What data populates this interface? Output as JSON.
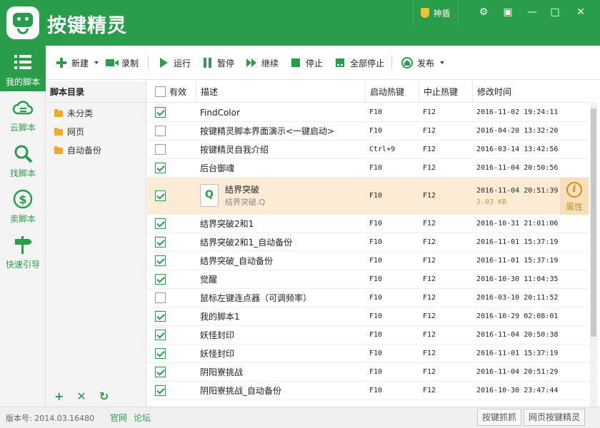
{
  "app": {
    "title": "按键精灵",
    "shield_label": "神盾"
  },
  "window_controls": {
    "settings": "⚙",
    "menu": "▣",
    "minimize": "—",
    "maximize": "□",
    "close": "✕"
  },
  "nav": [
    {
      "label": "我的脚本",
      "icon": "list-icon",
      "active": true
    },
    {
      "label": "云脚本",
      "icon": "cloud-icon",
      "active": false
    },
    {
      "label": "找脚本",
      "icon": "search-icon",
      "active": false
    },
    {
      "label": "卖脚本",
      "icon": "dollar-icon",
      "active": false
    },
    {
      "label": "快速引导",
      "icon": "signpost-icon",
      "active": false
    }
  ],
  "toolbar": {
    "new": "新建",
    "record": "录制",
    "run": "运行",
    "pause": "暂停",
    "resume": "继续",
    "stop": "停止",
    "stop_all": "全部停止",
    "publish": "发布"
  },
  "tree": {
    "header": "脚本目录",
    "folders": [
      "未分类",
      "网页",
      "自动备份"
    ],
    "actions": {
      "add": "+",
      "delete": "✕",
      "refresh": "↻"
    }
  },
  "grid": {
    "columns": [
      "有效",
      "描述",
      "启动热键",
      "中止热键",
      "修改时间"
    ],
    "rows": [
      {
        "enabled": true,
        "desc": "FindColor",
        "start": "F10",
        "stop": "F12",
        "time": "2016-11-02 19:24:11"
      },
      {
        "enabled": false,
        "desc": "按键精灵脚本界面演示<一键启动>",
        "start": "F10",
        "stop": "F12",
        "time": "2016-04-20 13:32:20"
      },
      {
        "enabled": false,
        "desc": "按键精灵自我介绍",
        "start": "Ctrl+9",
        "stop": "F12",
        "time": "2016-03-14 13:42:56"
      },
      {
        "enabled": true,
        "desc": "后台御魂",
        "start": "F10",
        "stop": "F12",
        "time": "2016-11-04 20:50:56"
      },
      {
        "enabled": true,
        "desc": "结界突破",
        "file": "结界突破.Q",
        "size": "2.03 KB",
        "start": "F10",
        "stop": "F12",
        "time": "2016-11-04 20:51:39",
        "selected": true,
        "prop_label": "属性"
      },
      {
        "enabled": true,
        "desc": "结界突破2和1",
        "start": "F10",
        "stop": "F12",
        "time": "2016-10-31 21:01:06"
      },
      {
        "enabled": true,
        "desc": "结界突破2和1_自动备份",
        "start": "F10",
        "stop": "F12",
        "time": "2016-11-01 15:37:19"
      },
      {
        "enabled": true,
        "desc": "结界突破_自动备份",
        "start": "F10",
        "stop": "F12",
        "time": "2016-11-01 15:37:19"
      },
      {
        "enabled": true,
        "desc": "觉醒",
        "start": "F10",
        "stop": "F12",
        "time": "2016-10-30 11:04:35"
      },
      {
        "enabled": false,
        "desc": "鼠标左键连点器（可调频率）",
        "start": "F10",
        "stop": "F12",
        "time": "2016-03-10 20:11:52"
      },
      {
        "enabled": true,
        "desc": "我的脚本1",
        "start": "F10",
        "stop": "F12",
        "time": "2016-10-29 02:08:01"
      },
      {
        "enabled": true,
        "desc": "妖怪封印",
        "start": "F10",
        "stop": "F12",
        "time": "2016-11-04 20:50:38"
      },
      {
        "enabled": true,
        "desc": "妖怪封印",
        "start": "F10",
        "stop": "F12",
        "time": "2016-11-01 15:37:19"
      },
      {
        "enabled": true,
        "desc": "阴阳寮挑战",
        "start": "F10",
        "stop": "F12",
        "time": "2016-11-04 20:51:29"
      },
      {
        "enabled": true,
        "desc": "阴阳寮挑战_自动备份",
        "start": "F10",
        "stop": "F12",
        "time": "2016-10-30 23:47:44"
      }
    ]
  },
  "status": {
    "version": "版本号: 2014.03.16480",
    "link_official": "官网",
    "link_forum": "论坛",
    "btn_capture": "按键抓抓",
    "btn_web": "网页按键精灵"
  },
  "colors": {
    "brand": "#2a9d4a",
    "selected_row": "#fcecd6",
    "accent_orange": "#d08c1c"
  }
}
